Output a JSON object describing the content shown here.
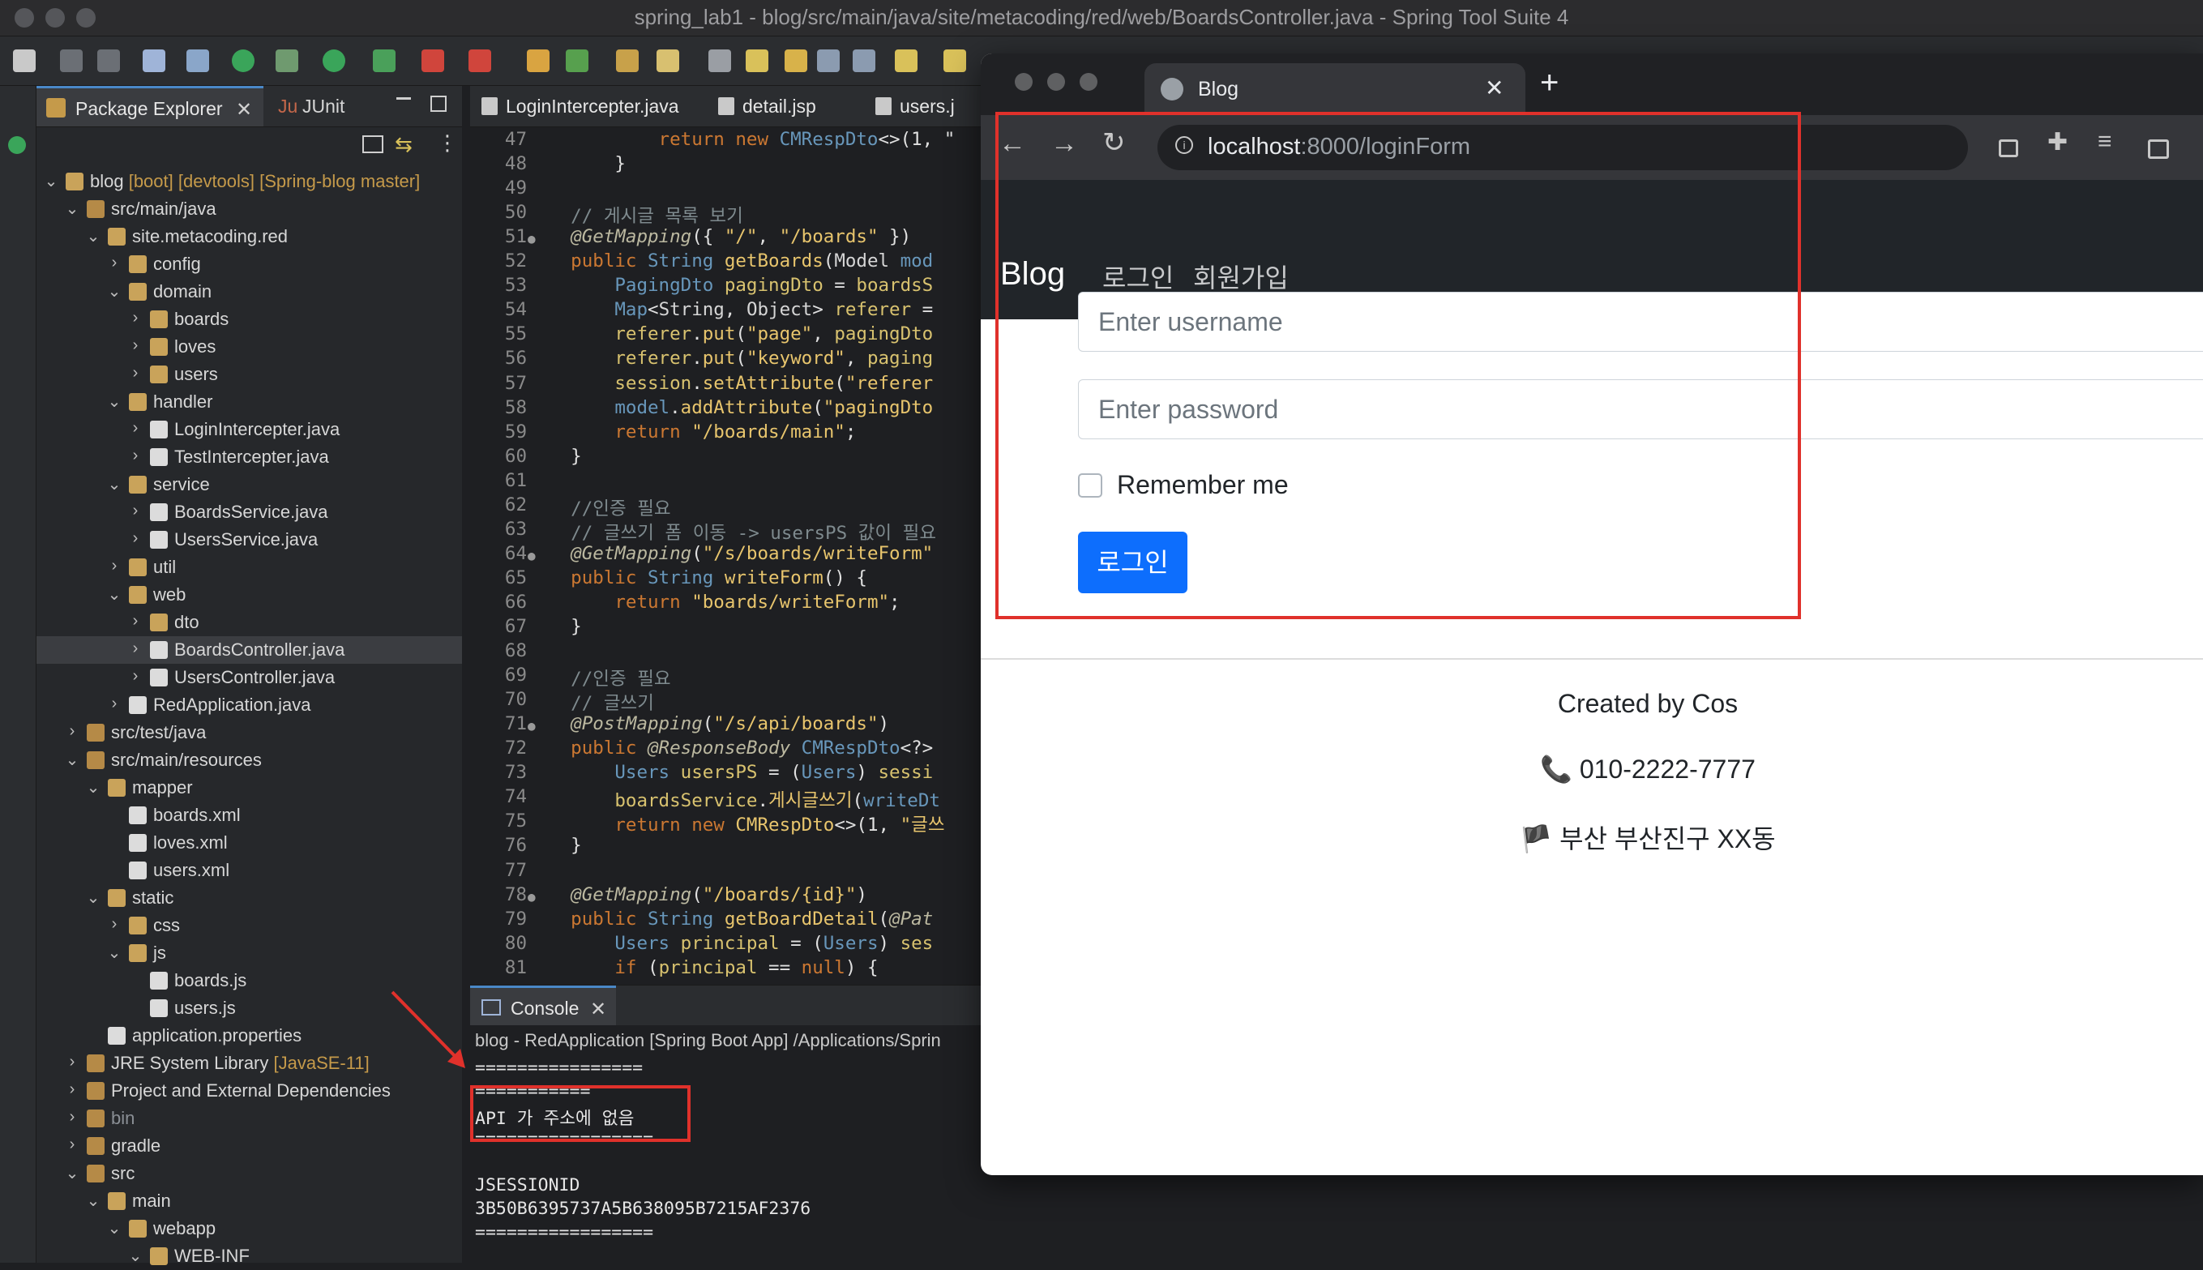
{
  "ide": {
    "window_title": "spring_lab1 - blog/src/main/java/site/metacoding/red/web/BoardsController.java - Spring Tool Suite 4",
    "explorer_tab": "Package Explorer",
    "junit_tab": "JUnit",
    "junit_prefix": "Ju",
    "tree": [
      {
        "label": "blog",
        "suffix": " [boot] [devtools] [Spring-blog master]",
        "indent": 0,
        "chev": "v"
      },
      {
        "label": "src/main/java",
        "indent": 1,
        "chev": "v"
      },
      {
        "label": "site.metacoding.red",
        "indent": 2,
        "chev": "v"
      },
      {
        "label": "config",
        "indent": 3,
        "chev": ">"
      },
      {
        "label": "domain",
        "indent": 3,
        "chev": "v"
      },
      {
        "label": "boards",
        "indent": 4,
        "chev": ">"
      },
      {
        "label": "loves",
        "indent": 4,
        "chev": ">"
      },
      {
        "label": "users",
        "indent": 4,
        "chev": ">"
      },
      {
        "label": "handler",
        "indent": 3,
        "chev": "v"
      },
      {
        "label": "LoginIntercepter.java",
        "indent": 4,
        "chev": ">"
      },
      {
        "label": "TestIntercepter.java",
        "indent": 4,
        "chev": ">"
      },
      {
        "label": "service",
        "indent": 3,
        "chev": "v"
      },
      {
        "label": "BoardsService.java",
        "indent": 4,
        "chev": ">"
      },
      {
        "label": "UsersService.java",
        "indent": 4,
        "chev": ">"
      },
      {
        "label": "util",
        "indent": 3,
        "chev": ">"
      },
      {
        "label": "web",
        "indent": 3,
        "chev": "v"
      },
      {
        "label": "dto",
        "indent": 4,
        "chev": ">"
      },
      {
        "label": "BoardsController.java",
        "indent": 4,
        "chev": ">",
        "selected": true
      },
      {
        "label": "UsersController.java",
        "indent": 4,
        "chev": ">"
      },
      {
        "label": "RedApplication.java",
        "indent": 3,
        "chev": ">"
      },
      {
        "label": "src/test/java",
        "indent": 1,
        "chev": ">"
      },
      {
        "label": "src/main/resources",
        "indent": 1,
        "chev": "v"
      },
      {
        "label": "mapper",
        "indent": 2,
        "chev": "v"
      },
      {
        "label": "boards.xml",
        "indent": 3,
        "chev": ""
      },
      {
        "label": "loves.xml",
        "indent": 3,
        "chev": ""
      },
      {
        "label": "users.xml",
        "indent": 3,
        "chev": ""
      },
      {
        "label": "static",
        "indent": 2,
        "chev": "v"
      },
      {
        "label": "css",
        "indent": 3,
        "chev": ">"
      },
      {
        "label": "js",
        "indent": 3,
        "chev": "v"
      },
      {
        "label": "boards.js",
        "indent": 4,
        "chev": ""
      },
      {
        "label": "users.js",
        "indent": 4,
        "chev": ""
      },
      {
        "label": "application.properties",
        "indent": 2,
        "chev": ""
      },
      {
        "label": "JRE System Library",
        "suffix": " [JavaSE-11]",
        "indent": 1,
        "chev": ">"
      },
      {
        "label": "Project and External Dependencies",
        "indent": 1,
        "chev": ">"
      },
      {
        "label": "bin",
        "indent": 1,
        "chev": ">",
        "dim": true
      },
      {
        "label": "gradle",
        "indent": 1,
        "chev": ">"
      },
      {
        "label": "src",
        "indent": 1,
        "chev": "v"
      },
      {
        "label": "main",
        "indent": 2,
        "chev": "v"
      },
      {
        "label": "webapp",
        "indent": 3,
        "chev": "v"
      },
      {
        "label": "WEB-INF",
        "indent": 4,
        "chev": "v"
      }
    ],
    "editor_tabs": [
      "LoginIntercepter.java",
      "detail.jsp",
      "users.j"
    ],
    "code_lines": [
      {
        "n": "47",
        "bp": false,
        "html": [
          [
            "kw",
            "            return new "
          ],
          [
            "ty",
            "CMRespDto"
          ],
          [
            "pl",
            "<>(1, \""
          ]
        ]
      },
      {
        "n": "48",
        "bp": false,
        "html": [
          [
            "pl",
            "        }"
          ]
        ]
      },
      {
        "n": "49",
        "bp": false,
        "html": [
          [
            "pl",
            ""
          ]
        ]
      },
      {
        "n": "50",
        "bp": false,
        "html": [
          [
            "cm",
            "    // 게시글 목록 보기"
          ]
        ]
      },
      {
        "n": "51",
        "bp": true,
        "html": [
          [
            "an",
            "    @GetMapping"
          ],
          [
            "pl",
            "({ "
          ],
          [
            "st",
            "\"/\""
          ],
          [
            "pl",
            ", "
          ],
          [
            "st",
            "\"/boards\""
          ],
          [
            "pl",
            " })"
          ]
        ]
      },
      {
        "n": "52",
        "bp": false,
        "html": [
          [
            "kw",
            "    public "
          ],
          [
            "ty",
            "String "
          ],
          [
            "mt",
            "getBoards"
          ],
          [
            "pl",
            "("
          ],
          [
            "fn",
            "Model "
          ],
          [
            "ty",
            "mod"
          ]
        ]
      },
      {
        "n": "53",
        "bp": false,
        "html": [
          [
            "ty",
            "        PagingDto "
          ],
          [
            "vr",
            "pagingDto"
          ],
          [
            "pl",
            " = "
          ],
          [
            "vr",
            "boardsS"
          ]
        ]
      },
      {
        "n": "54",
        "bp": false,
        "html": [
          [
            "ty",
            "        Map"
          ],
          [
            "pl",
            "<"
          ],
          [
            "fn",
            "String"
          ],
          [
            "pl",
            ", "
          ],
          [
            "fn",
            "Object"
          ],
          [
            "pl",
            "> "
          ],
          [
            "vr",
            "referer"
          ],
          [
            "pl",
            " ="
          ]
        ]
      },
      {
        "n": "55",
        "bp": false,
        "html": [
          [
            "vr",
            "        referer"
          ],
          [
            "pl",
            "."
          ],
          [
            "mt",
            "put"
          ],
          [
            "pl",
            "("
          ],
          [
            "st",
            "\"page\""
          ],
          [
            "pl",
            ", "
          ],
          [
            "vr",
            "pagingDto"
          ]
        ]
      },
      {
        "n": "56",
        "bp": false,
        "html": [
          [
            "vr",
            "        referer"
          ],
          [
            "pl",
            "."
          ],
          [
            "mt",
            "put"
          ],
          [
            "pl",
            "("
          ],
          [
            "st",
            "\"keyword\""
          ],
          [
            "pl",
            ", "
          ],
          [
            "vr",
            "paging"
          ]
        ]
      },
      {
        "n": "57",
        "bp": false,
        "html": [
          [
            "vr",
            "        session"
          ],
          [
            "pl",
            "."
          ],
          [
            "mt",
            "setAttribute"
          ],
          [
            "pl",
            "("
          ],
          [
            "st",
            "\"referer"
          ]
        ]
      },
      {
        "n": "58",
        "bp": false,
        "html": [
          [
            "ty",
            "        model"
          ],
          [
            "pl",
            "."
          ],
          [
            "mt",
            "addAttribute"
          ],
          [
            "pl",
            "("
          ],
          [
            "st",
            "\"pagingDto"
          ]
        ]
      },
      {
        "n": "59",
        "bp": false,
        "html": [
          [
            "kw",
            "        return "
          ],
          [
            "st",
            "\"/boards/main\""
          ],
          [
            "pl",
            ";"
          ]
        ]
      },
      {
        "n": "60",
        "bp": false,
        "html": [
          [
            "pl",
            "    }"
          ]
        ]
      },
      {
        "n": "61",
        "bp": false,
        "html": [
          [
            "pl",
            ""
          ]
        ]
      },
      {
        "n": "62",
        "bp": false,
        "html": [
          [
            "cm",
            "    //인증 필요"
          ]
        ]
      },
      {
        "n": "63",
        "bp": false,
        "html": [
          [
            "cm",
            "    // 글쓰기 폼 이동 -> usersPS 값이 필요"
          ]
        ]
      },
      {
        "n": "64",
        "bp": true,
        "html": [
          [
            "an",
            "    @GetMapping"
          ],
          [
            "pl",
            "("
          ],
          [
            "st",
            "\"/s/boards/writeForm\""
          ]
        ]
      },
      {
        "n": "65",
        "bp": false,
        "html": [
          [
            "kw",
            "    public "
          ],
          [
            "ty",
            "String "
          ],
          [
            "mt",
            "writeForm"
          ],
          [
            "pl",
            "() {"
          ]
        ]
      },
      {
        "n": "66",
        "bp": false,
        "html": [
          [
            "kw",
            "        return "
          ],
          [
            "st",
            "\"boards/writeForm\""
          ],
          [
            "pl",
            ";"
          ]
        ]
      },
      {
        "n": "67",
        "bp": false,
        "html": [
          [
            "pl",
            "    }"
          ]
        ]
      },
      {
        "n": "68",
        "bp": false,
        "html": [
          [
            "pl",
            ""
          ]
        ]
      },
      {
        "n": "69",
        "bp": false,
        "html": [
          [
            "cm",
            "    //인증 필요"
          ]
        ]
      },
      {
        "n": "70",
        "bp": false,
        "html": [
          [
            "cm",
            "    // 글쓰기"
          ]
        ]
      },
      {
        "n": "71",
        "bp": true,
        "html": [
          [
            "an",
            "    @PostMapping"
          ],
          [
            "pl",
            "("
          ],
          [
            "st",
            "\"/s/api/boards\""
          ],
          [
            "pl",
            ")"
          ]
        ]
      },
      {
        "n": "72",
        "bp": false,
        "html": [
          [
            "kw",
            "    public "
          ],
          [
            "an",
            "@ResponseBody "
          ],
          [
            "ty",
            "CMRespDto"
          ],
          [
            "pl",
            "<?>"
          ]
        ]
      },
      {
        "n": "73",
        "bp": false,
        "html": [
          [
            "ty",
            "        Users "
          ],
          [
            "vr",
            "usersPS"
          ],
          [
            "pl",
            " = ("
          ],
          [
            "ty",
            "Users"
          ],
          [
            "pl",
            ") "
          ],
          [
            "vr",
            "sessi"
          ]
        ]
      },
      {
        "n": "74",
        "bp": false,
        "html": [
          [
            "vr",
            "        boardsService"
          ],
          [
            "pl",
            "."
          ],
          [
            "mt",
            "게시글쓰기"
          ],
          [
            "pl",
            "("
          ],
          [
            "ty",
            "writeDt"
          ]
        ]
      },
      {
        "n": "75",
        "bp": false,
        "html": [
          [
            "kw",
            "        return new "
          ],
          [
            "mt",
            "CMRespDto"
          ],
          [
            "pl",
            "<>(1, "
          ],
          [
            "st",
            "\"글쓰"
          ]
        ]
      },
      {
        "n": "76",
        "bp": false,
        "html": [
          [
            "pl",
            "    }"
          ]
        ]
      },
      {
        "n": "77",
        "bp": false,
        "html": [
          [
            "pl",
            ""
          ]
        ]
      },
      {
        "n": "78",
        "bp": true,
        "html": [
          [
            "an",
            "    @GetMapping"
          ],
          [
            "pl",
            "("
          ],
          [
            "st",
            "\"/boards/{id}\""
          ],
          [
            "pl",
            ")"
          ]
        ]
      },
      {
        "n": "79",
        "bp": false,
        "html": [
          [
            "kw",
            "    public "
          ],
          [
            "ty",
            "String "
          ],
          [
            "mt",
            "getBoardDetail"
          ],
          [
            "pl",
            "("
          ],
          [
            "an",
            "@Pat"
          ]
        ]
      },
      {
        "n": "80",
        "bp": false,
        "html": [
          [
            "ty",
            "        Users "
          ],
          [
            "vr",
            "principal"
          ],
          [
            "pl",
            " = ("
          ],
          [
            "ty",
            "Users"
          ],
          [
            "pl",
            ") "
          ],
          [
            "vr",
            "ses"
          ]
        ]
      },
      {
        "n": "81",
        "bp": false,
        "html": [
          [
            "kw",
            "        if "
          ],
          [
            "pl",
            "("
          ],
          [
            "vr",
            "principal"
          ],
          [
            "pl",
            " == "
          ],
          [
            "kw",
            "null"
          ],
          [
            "pl",
            ") {"
          ]
        ]
      }
    ],
    "console": {
      "tab": "Console",
      "header": "blog - RedApplication [Spring Boot App] /Applications/Sprin",
      "lines": [
        "================",
        "===========",
        "API 가 주소에 없음",
        "=================",
        "",
        "JSESSIONID",
        "3B50B6395737A5B638095B7215AF2376",
        "================="
      ]
    }
  },
  "browser": {
    "tab_title": "Blog",
    "url_host": "localhost",
    "url_path": ":8000/loginForm",
    "new_tab_symbol": "+",
    "brand": "Blog",
    "nav_links": [
      "로그인",
      "회원가입"
    ],
    "username_placeholder": "Enter username",
    "password_placeholder": "Enter password",
    "remember_label": "Remember me",
    "login_button": "로그인",
    "footer": {
      "created_by": "Created by Cos",
      "phone": "📞 010-2222-7777",
      "address": "🏴 부산 부산진구 XX동"
    }
  },
  "colors": {
    "annotation_red": "#e0312b",
    "login_blue": "#0d6efd",
    "navbar_dark": "#212529"
  }
}
